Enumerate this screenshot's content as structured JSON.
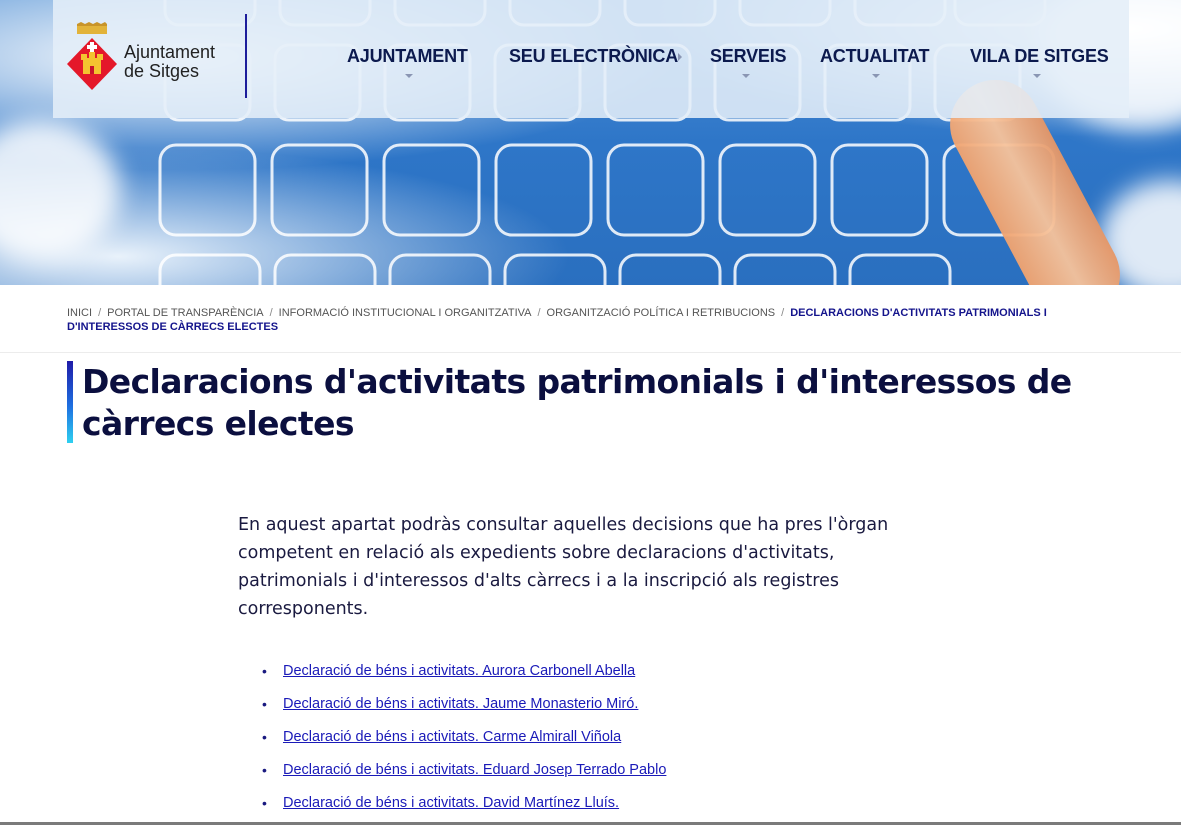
{
  "site": {
    "logo_line1": "Ajuntament",
    "logo_line2": "de Sitges"
  },
  "nav": {
    "items": [
      {
        "label": "AJUNTAMENT"
      },
      {
        "label": "SEU ELECTRÒNICA"
      },
      {
        "label": "SERVEIS"
      },
      {
        "label": "ACTUALITAT"
      },
      {
        "label": "VILA DE SITGES"
      }
    ]
  },
  "breadcrumb": {
    "items": [
      {
        "label": "Inici"
      },
      {
        "label": "Portal de Transparència"
      },
      {
        "label": "Informació institucional i organitzativa"
      },
      {
        "label": "Organització política i retribucions"
      }
    ],
    "current": "Declaracions d'activitats patrimonials i d'interessos de càrrecs electes"
  },
  "page": {
    "title": "Declaracions d'activitats patrimonials i d'interessos de càrrecs electes",
    "intro": "En aquest apartat podràs consultar aquelles decisions que ha pres l'òrgan competent en relació als expedients sobre declaracions d'activitats, patrimonials i d'interessos d'alts càrrecs i a la inscripció als registres corresponents.",
    "documents": [
      {
        "label": "Declaració de béns i activitats. Aurora Carbonell Abella"
      },
      {
        "label": "Declaració de béns i activitats. Jaume Monasterio Miró."
      },
      {
        "label": "Declaració de béns i activitats. Carme Almirall Viñola"
      },
      {
        "label": "Declaració de béns i activitats. Eduard Josep Terrado Pablo"
      },
      {
        "label": "Declaració de béns i activitats. David Martínez Lluís."
      }
    ]
  },
  "colors": {
    "brand_navy": "#0b0f3f",
    "link": "#1a1ab8",
    "accent_gradient_top": "#1f1ba8",
    "accent_gradient_bottom": "#2ed0f0"
  }
}
